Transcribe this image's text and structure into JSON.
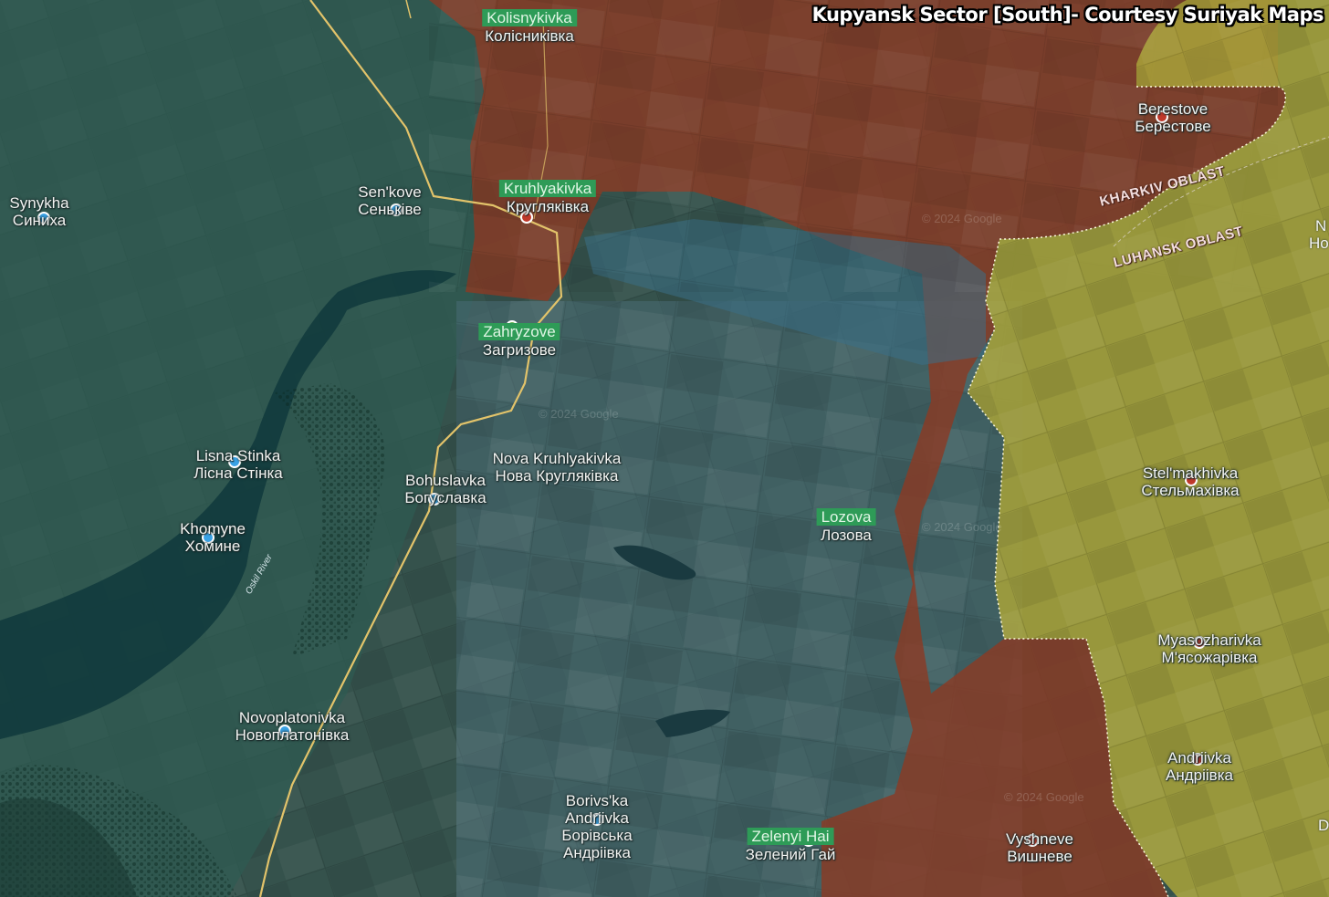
{
  "map_title": "Kupyansk Sector [South]- Courtesy Suriyak Maps",
  "watermark": "© 2024 Google",
  "colors": {
    "russian_controlled": "#8a3a24",
    "ukrainian_controlled_luhansk": "#a9a33a",
    "contested_blue": "#3b6f86",
    "terrain": "#35524c",
    "water": "#123b3d",
    "road": "#e2c36a",
    "label_highlight": "#2e9b57"
  },
  "places": [
    {
      "lat": "Kolisnykivka",
      "cyr": "Колісниківка",
      "dot": "green",
      "highlight": true
    },
    {
      "lat": "Synykha",
      "cyr": "Синиха",
      "dot": "blue",
      "highlight": false
    },
    {
      "lat": "Sen'kove",
      "cyr": "Сеньківе",
      "dot": "blue",
      "highlight": false
    },
    {
      "lat": "Kruhlyakivka",
      "cyr": "Кругляківка",
      "dot": "red",
      "highlight": true
    },
    {
      "lat": "Zahryzove",
      "cyr": "Загризове",
      "dot": "green",
      "highlight": true
    },
    {
      "lat": "Berestove",
      "cyr": "Берестове",
      "dot": "red",
      "highlight": false
    },
    {
      "lat": "Lisna Stinka",
      "cyr": "Лісна Стінка",
      "dot": "blue",
      "highlight": false
    },
    {
      "lat": "Bohuslavka",
      "cyr": "Богуславка",
      "dot": "blue",
      "highlight": false
    },
    {
      "lat": "Nova Kruhlyakivka",
      "cyr": "Нова Кругляківка",
      "dot": "none",
      "highlight": false
    },
    {
      "lat": "Khomyne",
      "cyr": "Хомине",
      "dot": "blue",
      "highlight": false
    },
    {
      "lat": "Lozova",
      "cyr": "Лозова",
      "dot": "green",
      "highlight": true
    },
    {
      "lat": "Stel'makhivka",
      "cyr": "Стельмахівка",
      "dot": "red",
      "highlight": false
    },
    {
      "lat": "Myasozharivka",
      "cyr": "М'ясожарівка",
      "dot": "red",
      "highlight": false
    },
    {
      "lat": "Novoplatonivka",
      "cyr": "Новоплатонівка",
      "dot": "blue",
      "highlight": false
    },
    {
      "lat": "Andriivka",
      "cyr": "Андріівка",
      "dot": "red",
      "highlight": false
    },
    {
      "lat": "Borivs'ka Andriivka",
      "cyr": "Борівська Андріівка",
      "dot": "blue",
      "highlight": false
    },
    {
      "lat": "Zelenyi Hai",
      "cyr": "Зелений Гай",
      "dot": "green",
      "highlight": true
    },
    {
      "lat": "Vyshneve",
      "cyr": "Вишневе",
      "dot": "red",
      "highlight": false
    }
  ],
  "oblast_labels": [
    "KHARKIV OBLAST",
    "LUHANSK OBLAST"
  ],
  "river_label": "Oskil River",
  "edge_labels": [
    "N",
    "Ho",
    "D"
  ]
}
